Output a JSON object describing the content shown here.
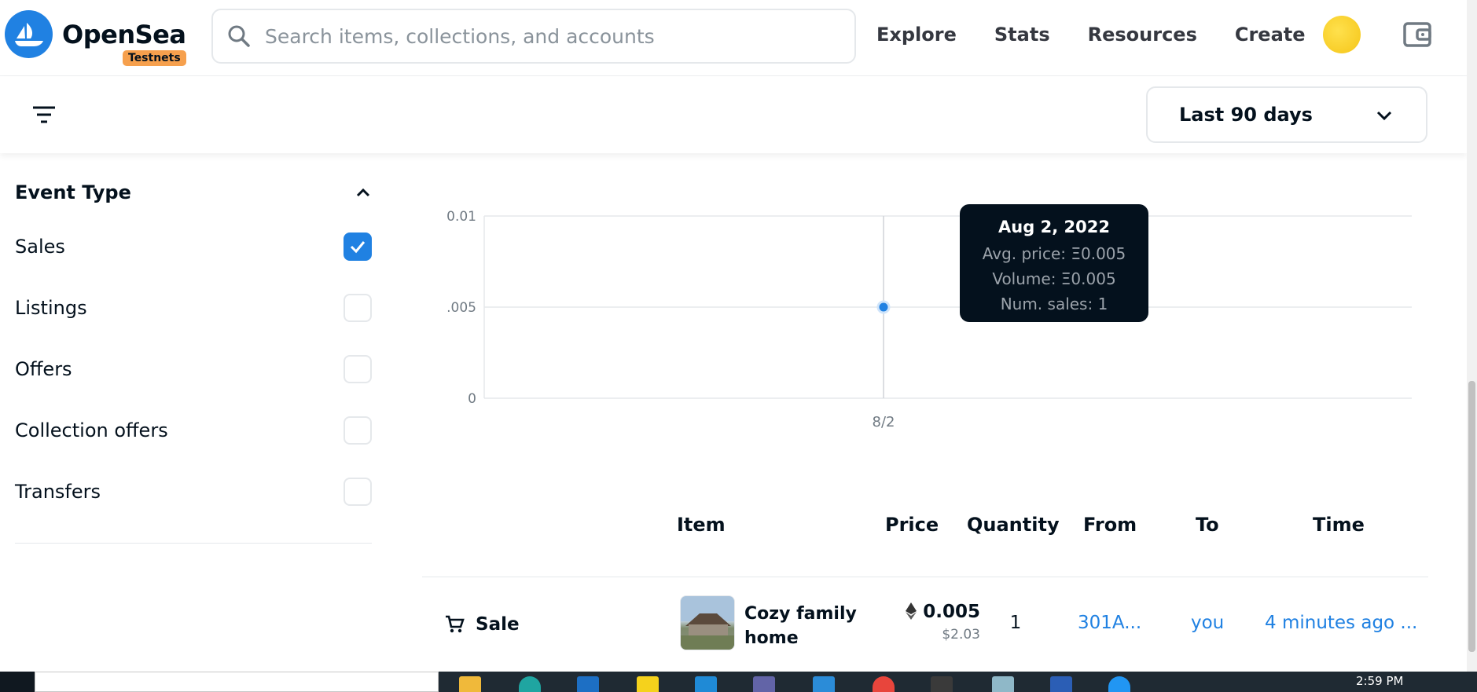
{
  "app": {
    "brand": "OpenSea",
    "network_badge": "Testnets"
  },
  "search": {
    "placeholder": "Search items, collections, and accounts"
  },
  "nav": {
    "items": [
      {
        "label": "Explore"
      },
      {
        "label": "Stats"
      },
      {
        "label": "Resources"
      },
      {
        "label": "Create"
      }
    ]
  },
  "filter_bar": {
    "period": "Last 90 days"
  },
  "sidebar": {
    "title": "Event Type",
    "items": [
      {
        "label": "Sales",
        "checked": true
      },
      {
        "label": "Listings",
        "checked": false
      },
      {
        "label": "Offers",
        "checked": false
      },
      {
        "label": "Collection offers",
        "checked": false
      },
      {
        "label": "Transfers",
        "checked": false
      }
    ]
  },
  "chart_data": {
    "type": "scatter",
    "x": [
      "8/2"
    ],
    "values": [
      0.005
    ],
    "y_ticks": [
      "0.01",
      ".005",
      "0"
    ],
    "ylim": [
      0,
      0.01
    ],
    "grid": true,
    "accent": "#2081e2",
    "tooltip": {
      "date": "Aug 2, 2022",
      "avg_price": "Avg. price: Ξ0.005",
      "volume": "Volume: Ξ0.005",
      "num_sales": "Num. sales: 1"
    }
  },
  "table": {
    "headers": {
      "item": "Item",
      "price": "Price",
      "quantity": "Quantity",
      "from": "From",
      "to": "To",
      "time": "Time"
    },
    "rows": [
      {
        "event": "Sale",
        "item_name": "Cozy family home",
        "price_eth": "0.005",
        "price_usd": "$2.03",
        "quantity": "1",
        "from": "301A...",
        "to": "you",
        "time": "4 minutes ago ..."
      }
    ]
  },
  "taskbar": {
    "time": "2:59 PM"
  },
  "colors": {
    "accent": "#2081e2",
    "badge": "#f6a04d",
    "tooltip_bg": "#04111d"
  }
}
